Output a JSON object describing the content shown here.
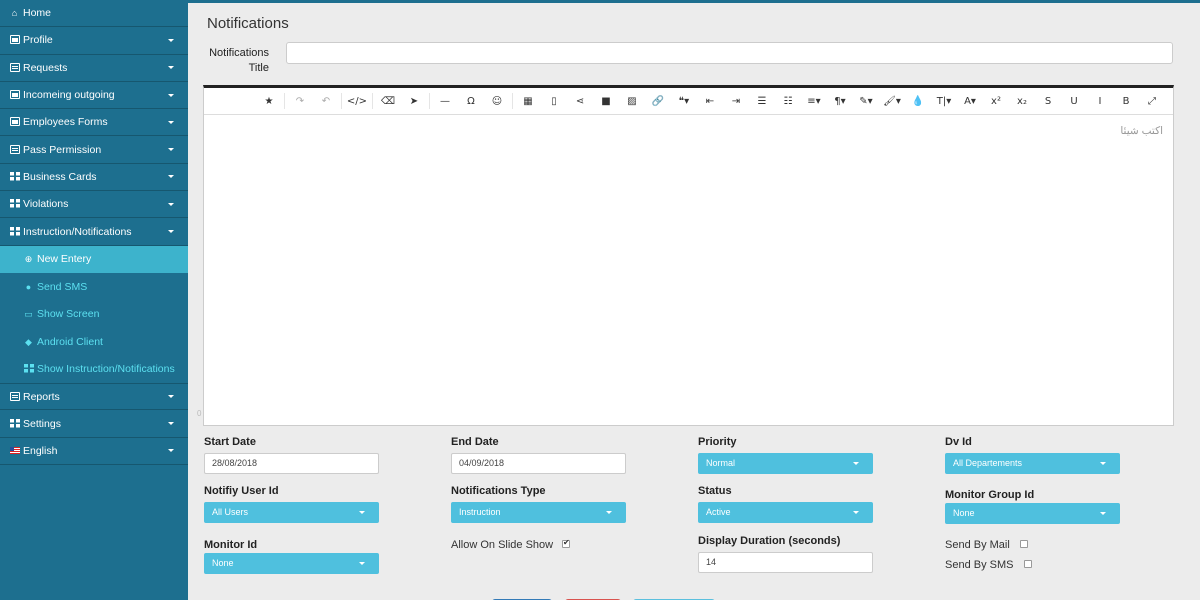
{
  "sidebar": {
    "items": [
      {
        "label": "Home",
        "icon": "home-icon",
        "caret": false
      },
      {
        "label": "Profile",
        "icon": "list-icon",
        "caret": true
      },
      {
        "label": "Requests",
        "icon": "list-icon",
        "caret": true
      },
      {
        "label": "Incomeing outgoing",
        "icon": "list-icon",
        "caret": true
      },
      {
        "label": "Employees Forms",
        "icon": "list-icon",
        "caret": true
      },
      {
        "label": "Pass Permission",
        "icon": "id-card-icon",
        "caret": true
      },
      {
        "label": "Business Cards",
        "icon": "grid-icon",
        "caret": true
      },
      {
        "label": "Violations",
        "icon": "grid-icon",
        "caret": true
      },
      {
        "label": "Instruction/Notifications",
        "icon": "grid-icon",
        "caret": true
      }
    ],
    "subitems": [
      {
        "label": "New Entery",
        "icon": "plus-circle-icon",
        "active": true
      },
      {
        "label": "Send SMS",
        "icon": "comment-icon",
        "active": false
      },
      {
        "label": "Show Screen",
        "icon": "monitor-icon",
        "active": false
      },
      {
        "label": "Android Client",
        "icon": "android-icon",
        "active": false
      },
      {
        "label": "Show Instruction/Notifications",
        "icon": "grid-icon",
        "active": false
      }
    ],
    "bottom_items": [
      {
        "label": "Reports",
        "icon": "list-icon",
        "caret": true
      },
      {
        "label": "Settings",
        "icon": "grid-icon",
        "caret": true
      },
      {
        "label": "English",
        "icon": "flag-icon",
        "caret": true
      }
    ]
  },
  "page": {
    "title": "Notifications",
    "notifications_title_label_1": "Notifications",
    "notifications_title_label_2": "Title",
    "title_value": ""
  },
  "editor": {
    "placeholder": "اكتب شيئا",
    "resize_glyph": "0",
    "toolbar": [
      {
        "name": "fullscreen-icon",
        "glyph": "⤢"
      },
      {
        "name": "bold-icon",
        "glyph": "B"
      },
      {
        "name": "italic-icon",
        "glyph": "I"
      },
      {
        "name": "underline-icon",
        "glyph": "U"
      },
      {
        "name": "strikethrough-icon",
        "glyph": "S"
      },
      {
        "name": "subscript-icon",
        "glyph": "x₂"
      },
      {
        "name": "superscript-icon",
        "glyph": "x²"
      },
      {
        "name": "font-color-icon",
        "glyph": "A▾"
      },
      {
        "name": "font-size-icon",
        "glyph": "T|▾"
      },
      {
        "name": "ink-drop-icon",
        "glyph": "💧"
      },
      {
        "name": "brush-icon",
        "glyph": "🖌▾"
      },
      {
        "name": "magic-wand-icon",
        "glyph": "✎▾"
      },
      {
        "name": "paragraph-icon",
        "glyph": "¶▾"
      },
      {
        "name": "align-icon",
        "glyph": "≡▾"
      },
      {
        "name": "ordered-list-icon",
        "glyph": "☷"
      },
      {
        "name": "unordered-list-icon",
        "glyph": "☰"
      },
      {
        "name": "indent-icon",
        "glyph": "⇥"
      },
      {
        "name": "outdent-icon",
        "glyph": "⇤"
      },
      {
        "name": "quote-icon",
        "glyph": "❝▾"
      },
      {
        "name": "link-icon",
        "glyph": "🔗"
      },
      {
        "name": "image-icon",
        "glyph": "▨"
      },
      {
        "name": "video-icon",
        "glyph": "■"
      },
      {
        "name": "share-icon",
        "glyph": "⋖"
      },
      {
        "name": "file-icon",
        "glyph": "▯"
      },
      {
        "name": "table-icon",
        "glyph": "▦"
      },
      {
        "name": "emoji-icon",
        "glyph": "☺"
      },
      {
        "name": "omega-icon",
        "glyph": "Ω"
      },
      {
        "name": "horizontal-rule-icon",
        "glyph": "—"
      },
      {
        "name": "cursor-icon",
        "glyph": "➤"
      },
      {
        "name": "eraser-icon",
        "glyph": "⌫"
      },
      {
        "name": "code-icon",
        "glyph": "</>"
      },
      {
        "name": "undo-icon",
        "glyph": "↶"
      },
      {
        "name": "redo-icon",
        "glyph": "↷"
      },
      {
        "name": "star-icon",
        "glyph": "★"
      }
    ]
  },
  "form": {
    "start_date": {
      "label": "Start Date",
      "value": "28/08/2018"
    },
    "end_date": {
      "label": "End Date",
      "value": "04/09/2018"
    },
    "priority": {
      "label": "Priority",
      "value": "Normal"
    },
    "dv_id": {
      "label": "Dv Id",
      "value": "All Departements"
    },
    "notify_user": {
      "label": "Notifiy User Id",
      "value": "All Users"
    },
    "notif_type": {
      "label": "Notifications Type",
      "value": "Instruction"
    },
    "status": {
      "label": "Status",
      "value": "Active"
    },
    "monitor_group": {
      "label": "Monitor Group Id",
      "value": "None"
    },
    "monitor_id": {
      "label": "Monitor Id",
      "value": "None"
    },
    "slide_show": {
      "label": "Allow On Slide Show",
      "checked": true
    },
    "display_duration": {
      "label": "Display Duration (seconds)",
      "value": "14"
    },
    "send_mail": {
      "label": "Send By Mail",
      "checked": false
    },
    "send_sms": {
      "label": "Send By SMS",
      "checked": false
    }
  },
  "colors": {
    "sidebar": "#1d6f8f",
    "active_sub": "#3db3cc",
    "sub_text": "#5ce0f0",
    "dropdown": "#4fc0de",
    "btn_save": "#337ab7",
    "btn_cancel": "#d9534f",
    "btn_other": "#5bc0de"
  }
}
